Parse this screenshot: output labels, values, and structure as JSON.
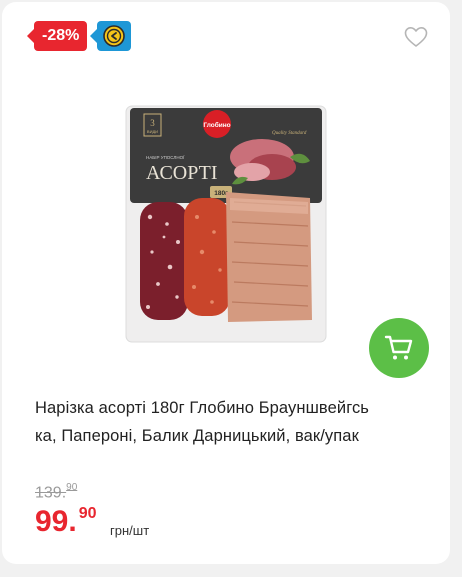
{
  "badges": {
    "discount": "-28%",
    "cashback_icon": "coin-back-icon"
  },
  "icons": {
    "favorite": "heart-outline-icon",
    "cart": "cart-icon"
  },
  "product": {
    "title": "Нарізка асорті 180г Глобино Брауншвейгська, Папероні, Балик Дарницький, вак/упак",
    "title_line1": "Нарізка асорті 180г Глобино Брауншвейгсь",
    "title_line2": "ка, Папероні, Балик Дарницький, вак/упак",
    "package": {
      "brand": "Глобино",
      "name": "АСОРТІ",
      "subtitle": "НАБІР УПОСЛНОЇ",
      "weight": "180г",
      "count": "3",
      "count_label": "ВИДИ",
      "quality": "Quality Standard"
    }
  },
  "price": {
    "old_int": "139.",
    "old_frac": "90",
    "current_int": "99.",
    "current_frac": "90",
    "unit": "грн/шт"
  },
  "colors": {
    "accent_red": "#e8262f",
    "cart_green": "#5cbf47",
    "cashback_blue": "#1e97d6"
  }
}
